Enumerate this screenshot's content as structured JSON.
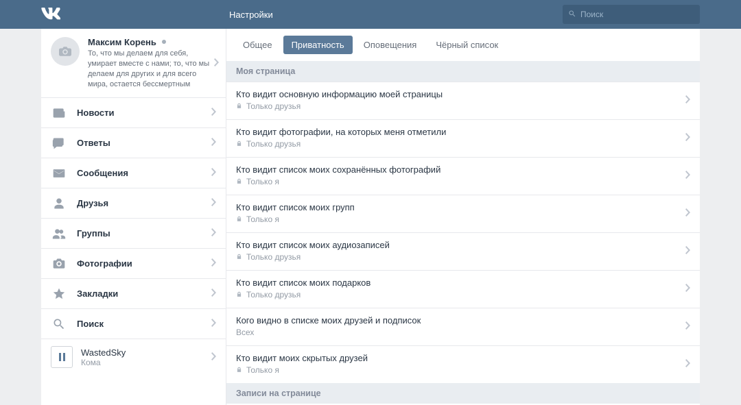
{
  "header": {
    "title": "Настройки",
    "search_placeholder": "Поиск"
  },
  "profile": {
    "name": "Максим Корень",
    "status": "То, что мы делаем для себя, умирает вместе с нами; то, что мы делаем для других и для всего мира, остается бессмертным"
  },
  "nav": [
    {
      "label": "Новости",
      "icon": "news"
    },
    {
      "label": "Ответы",
      "icon": "replies"
    },
    {
      "label": "Сообщения",
      "icon": "messages"
    },
    {
      "label": "Друзья",
      "icon": "friend"
    },
    {
      "label": "Группы",
      "icon": "groups"
    },
    {
      "label": "Фотографии",
      "icon": "camera"
    },
    {
      "label": "Закладки",
      "icon": "star"
    },
    {
      "label": "Поиск",
      "icon": "search"
    }
  ],
  "player": {
    "title": "WastedSky",
    "artist": "Кома"
  },
  "tabs": [
    {
      "label": "Общее",
      "active": false
    },
    {
      "label": "Приватность",
      "active": true
    },
    {
      "label": "Оповещения",
      "active": false
    },
    {
      "label": "Чёрный список",
      "active": false
    }
  ],
  "sections": [
    {
      "title": "Моя страница",
      "rows": [
        {
          "title": "Кто видит основную информацию моей страницы",
          "value": "Только друзья",
          "locked": true
        },
        {
          "title": "Кто видит фотографии, на которых меня отметили",
          "value": "Только друзья",
          "locked": true
        },
        {
          "title": "Кто видит список моих сохранённых фотографий",
          "value": "Только я",
          "locked": true
        },
        {
          "title": "Кто видит список моих групп",
          "value": "Только я",
          "locked": true
        },
        {
          "title": "Кто видит список моих аудиозаписей",
          "value": "Только друзья",
          "locked": true
        },
        {
          "title": "Кто видит список моих подарков",
          "value": "Только друзья",
          "locked": true
        },
        {
          "title": "Кого видно в списке моих друзей и подписок",
          "value": "Всех",
          "locked": false
        },
        {
          "title": "Кто видит моих скрытых друзей",
          "value": "Только я",
          "locked": true
        }
      ]
    },
    {
      "title": "Записи на странице",
      "rows": []
    }
  ]
}
